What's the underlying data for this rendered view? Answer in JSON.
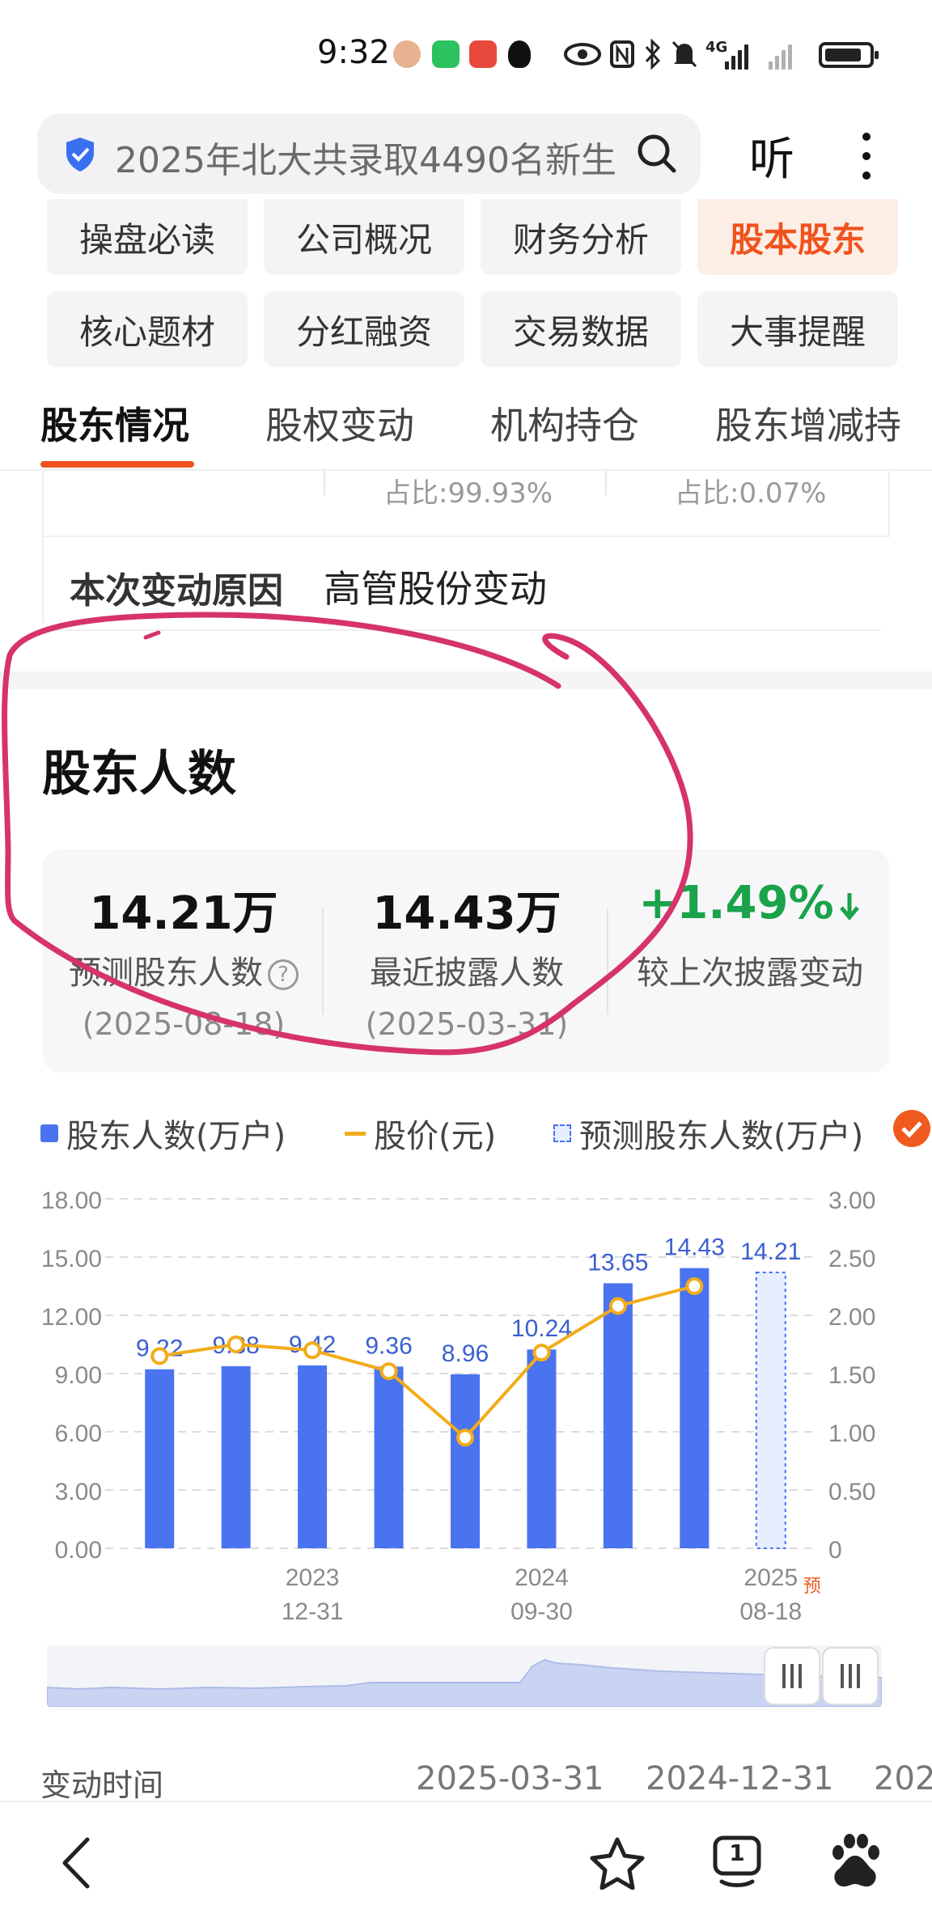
{
  "status_bar": {
    "time": "9:32",
    "network": "4G",
    "icons": [
      "avatar-icon",
      "wechat-icon",
      "app-icon",
      "qq-icon",
      "eye-icon",
      "nfc-icon",
      "bluetooth-icon",
      "mute-icon",
      "signal-icon",
      "battery-icon"
    ]
  },
  "search": {
    "query": "2025年北大共录取4490名新生",
    "listen_label": "听"
  },
  "nav_grid": {
    "row1": [
      "操盘必读",
      "公司概况",
      "财务分析",
      "股本股东"
    ],
    "row2": [
      "核心题材",
      "分红融资",
      "交易数据",
      "大事提醒"
    ],
    "active": "股本股东"
  },
  "sub_tabs": {
    "items": [
      "股东情况",
      "股权变动",
      "机构持仓",
      "股东增减持"
    ],
    "active": "股东情况"
  },
  "change_card": {
    "ratio_left": "占比:99.93%",
    "ratio_right": "占比:0.07%",
    "reason_label": "本次变动原因",
    "reason_value": "高管股份变动"
  },
  "holders_section": {
    "title": "股东人数",
    "stats": [
      {
        "value": "14.21万",
        "label": "预测股东人数",
        "date": "(2025-08-18)"
      },
      {
        "value": "14.43万",
        "label": "最近披露人数",
        "date": "(2025-03-31)"
      },
      {
        "value": "+1.49%",
        "label": "较上次披露变动",
        "date": ""
      }
    ]
  },
  "colors": {
    "accent": "#f0521e",
    "bar": "#4a73f0",
    "price_line": "#f2ac1a",
    "positive": "#1aa34a",
    "annotation": "#d6336c"
  },
  "chart_data": {
    "type": "bar",
    "legend": [
      "股东人数(万户)",
      "股价(元)",
      "预测股东人数(万户)"
    ],
    "categories": [
      "",
      "",
      "2023-12-31",
      "",
      "",
      "2024-09-30",
      "",
      "",
      "2025-08-18"
    ],
    "x_tick_labels": [
      {
        "year": "2023",
        "date": "12-31"
      },
      {
        "year": "2024",
        "date": "09-30"
      },
      {
        "year": "2025",
        "date": "08-18"
      }
    ],
    "forecast_tag": "预",
    "series": [
      {
        "name": "股东人数(万户)",
        "type": "bar",
        "values": [
          9.22,
          9.38,
          9.42,
          9.36,
          8.96,
          10.24,
          13.65,
          14.43,
          null
        ]
      },
      {
        "name": "股价(元)",
        "type": "line",
        "axis": "right",
        "values": [
          1.65,
          1.75,
          1.7,
          1.52,
          0.95,
          1.68,
          2.08,
          2.25,
          null
        ]
      },
      {
        "name": "预测股东人数(万户)",
        "type": "bar",
        "values": [
          null,
          null,
          null,
          null,
          null,
          null,
          null,
          null,
          14.21
        ]
      }
    ],
    "data_labels": [
      "9.22",
      "9.38",
      "9.42",
      "9.36",
      "8.96",
      "10.24",
      "13.65",
      "14.43",
      "14.21"
    ],
    "ylim_left": [
      0,
      18
    ],
    "ylim_right": [
      0,
      3
    ],
    "y_ticks_left": [
      "0.00",
      "3.00",
      "6.00",
      "9.00",
      "12.00",
      "15.00",
      "18.00"
    ],
    "y_ticks_right": [
      "0",
      "0.50",
      "1.00",
      "1.50",
      "2.00",
      "2.50",
      "3.00"
    ],
    "grid": true,
    "legend_position": "top-left"
  },
  "change_time_row": {
    "label": "变动时间",
    "values": [
      "2025-03-31",
      "2024-12-31",
      "202"
    ]
  },
  "bottom_nav": {
    "page_count": "1",
    "icons": [
      "back-icon",
      "favorite-star-icon",
      "tabs-icon",
      "baidu-paw-icon"
    ]
  }
}
